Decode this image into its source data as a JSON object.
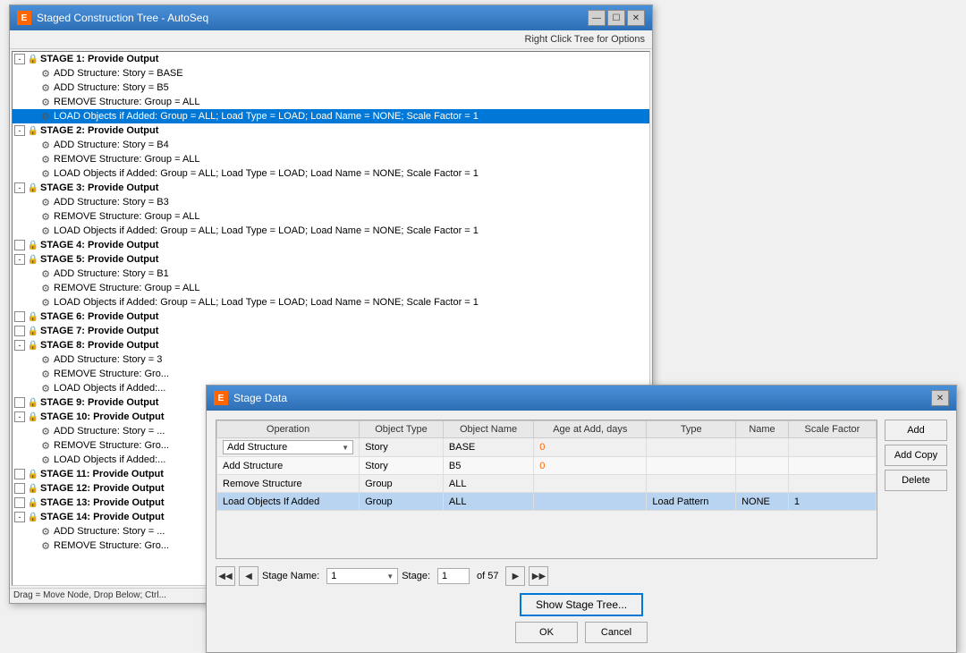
{
  "mainWindow": {
    "title": "Staged Construction Tree - AutoSeq",
    "hint": "Right Click Tree for Options",
    "statusBar": "Drag = Move Node, Drop Below;   Ctrl..."
  },
  "stageDialog": {
    "title": "Stage Data",
    "columns": [
      "Operation",
      "Object Type",
      "Object Name",
      "Age at Add, days",
      "Type",
      "Name",
      "Scale Factor"
    ],
    "rows": [
      {
        "operation": "Add Structure",
        "operationDropdown": true,
        "objectType": "Story",
        "objectName": "BASE",
        "ageAtAdd": "0",
        "type": "",
        "name": "",
        "scaleFactor": ""
      },
      {
        "operation": "Add Structure",
        "operationDropdown": false,
        "objectType": "Story",
        "objectName": "B5",
        "ageAtAdd": "0",
        "type": "",
        "name": "",
        "scaleFactor": ""
      },
      {
        "operation": "Remove Structure",
        "operationDropdown": false,
        "objectType": "Group",
        "objectName": "ALL",
        "ageAtAdd": "",
        "type": "",
        "name": "",
        "scaleFactor": ""
      },
      {
        "operation": "Load Objects If Added",
        "operationDropdown": false,
        "objectType": "Group",
        "objectName": "ALL",
        "ageAtAdd": "",
        "type": "Load Pattern",
        "name": "NONE",
        "scaleFactor": "1"
      }
    ],
    "selectedRowIndex": 3,
    "buttons": {
      "add": "Add",
      "addCopy": "Add Copy",
      "delete": "Delete"
    },
    "navigation": {
      "stageLabel": "Stage Name:",
      "stageName": "1",
      "stageNumLabel": "Stage:",
      "stageNum": "1",
      "ofLabel": "of 57"
    },
    "showStageBtn": "Show Stage Tree...",
    "okBtn": "OK",
    "cancelBtn": "Cancel"
  },
  "treeItems": [
    {
      "level": 0,
      "type": "stage",
      "text": "STAGE 1:   Provide Output",
      "hasExpand": true,
      "expanded": true,
      "hasLock": true,
      "selected": false
    },
    {
      "level": 1,
      "type": "action",
      "text": "ADD Structure:   Story = BASE",
      "selected": false
    },
    {
      "level": 1,
      "type": "action",
      "text": "ADD Structure:   Story = B5",
      "selected": false
    },
    {
      "level": 1,
      "type": "action",
      "text": "REMOVE Structure:   Group = ALL",
      "selected": false
    },
    {
      "level": 1,
      "type": "action",
      "text": "LOAD Objects if Added:   Group = ALL;   Load Type = LOAD;   Load Name = NONE;   Scale Factor = 1",
      "selected": true
    },
    {
      "level": 0,
      "type": "stage",
      "text": "STAGE 2:   Provide Output",
      "hasExpand": true,
      "expanded": true,
      "hasLock": true,
      "selected": false
    },
    {
      "level": 1,
      "type": "action",
      "text": "ADD Structure:   Story = B4",
      "selected": false
    },
    {
      "level": 1,
      "type": "action",
      "text": "REMOVE Structure:   Group = ALL",
      "selected": false
    },
    {
      "level": 1,
      "type": "action",
      "text": "LOAD Objects if Added:   Group = ALL;   Load Type = LOAD;   Load Name = NONE;   Scale Factor = 1",
      "selected": false
    },
    {
      "level": 0,
      "type": "stage",
      "text": "STAGE 3:   Provide Output",
      "hasExpand": true,
      "expanded": true,
      "hasLock": true,
      "selected": false
    },
    {
      "level": 1,
      "type": "action",
      "text": "ADD Structure:   Story = B3",
      "selected": false
    },
    {
      "level": 1,
      "type": "action",
      "text": "REMOVE Structure:   Group = ALL",
      "selected": false
    },
    {
      "level": 1,
      "type": "action",
      "text": "LOAD Objects if Added:   Group = ALL;   Load Type = LOAD;   Load Name = NONE;   Scale Factor = 1",
      "selected": false
    },
    {
      "level": 0,
      "type": "stage",
      "text": "STAGE 4:   Provide Output",
      "hasExpand": false,
      "expanded": false,
      "hasLock": true,
      "selected": false
    },
    {
      "level": 0,
      "type": "stage",
      "text": "STAGE 5:   Provide Output",
      "hasExpand": true,
      "expanded": true,
      "hasLock": true,
      "selected": false
    },
    {
      "level": 1,
      "type": "action",
      "text": "ADD Structure:   Story = B1",
      "selected": false
    },
    {
      "level": 1,
      "type": "action",
      "text": "REMOVE Structure:   Group = ALL",
      "selected": false
    },
    {
      "level": 1,
      "type": "action",
      "text": "LOAD Objects if Added:   Group = ALL;   Load Type = LOAD;   Load Name = NONE;   Scale Factor = 1",
      "selected": false
    },
    {
      "level": 0,
      "type": "stage",
      "text": "STAGE 6:   Provide Output",
      "hasExpand": false,
      "expanded": false,
      "hasLock": true,
      "selected": false
    },
    {
      "level": 0,
      "type": "stage",
      "text": "STAGE 7:   Provide Output",
      "hasExpand": false,
      "expanded": false,
      "hasLock": true,
      "selected": false
    },
    {
      "level": 0,
      "type": "stage",
      "text": "STAGE 8:   Provide Output",
      "hasExpand": true,
      "expanded": true,
      "hasLock": true,
      "selected": false
    },
    {
      "level": 1,
      "type": "action",
      "text": "ADD Structure:   Story = 3",
      "selected": false
    },
    {
      "level": 1,
      "type": "action",
      "text": "REMOVE Structure:   Gro...",
      "selected": false
    },
    {
      "level": 1,
      "type": "action",
      "text": "LOAD Objects if Added:...",
      "selected": false
    },
    {
      "level": 0,
      "type": "stage",
      "text": "STAGE 9:   Provide Output",
      "hasExpand": false,
      "expanded": false,
      "hasLock": true,
      "selected": false
    },
    {
      "level": 0,
      "type": "stage",
      "text": "STAGE 10:   Provide Output",
      "hasExpand": true,
      "expanded": true,
      "hasLock": true,
      "selected": false
    },
    {
      "level": 1,
      "type": "action",
      "text": "ADD Structure:   Story = ...",
      "selected": false
    },
    {
      "level": 1,
      "type": "action",
      "text": "REMOVE Structure:   Gro...",
      "selected": false
    },
    {
      "level": 1,
      "type": "action",
      "text": "LOAD Objects if Added:...",
      "selected": false
    },
    {
      "level": 0,
      "type": "stage",
      "text": "STAGE 11:   Provide Output",
      "hasExpand": false,
      "expanded": false,
      "hasLock": true,
      "selected": false
    },
    {
      "level": 0,
      "type": "stage",
      "text": "STAGE 12:   Provide Output",
      "hasExpand": false,
      "expanded": false,
      "hasLock": true,
      "selected": false
    },
    {
      "level": 0,
      "type": "stage",
      "text": "STAGE 13:   Provide Output",
      "hasExpand": false,
      "expanded": false,
      "hasLock": true,
      "selected": false
    },
    {
      "level": 0,
      "type": "stage",
      "text": "STAGE 14:   Provide Output",
      "hasExpand": true,
      "expanded": true,
      "hasLock": true,
      "selected": false
    },
    {
      "level": 1,
      "type": "action",
      "text": "ADD Structure:   Story = ...",
      "selected": false
    },
    {
      "level": 1,
      "type": "action",
      "text": "REMOVE Structure:   Gro...",
      "selected": false
    }
  ]
}
